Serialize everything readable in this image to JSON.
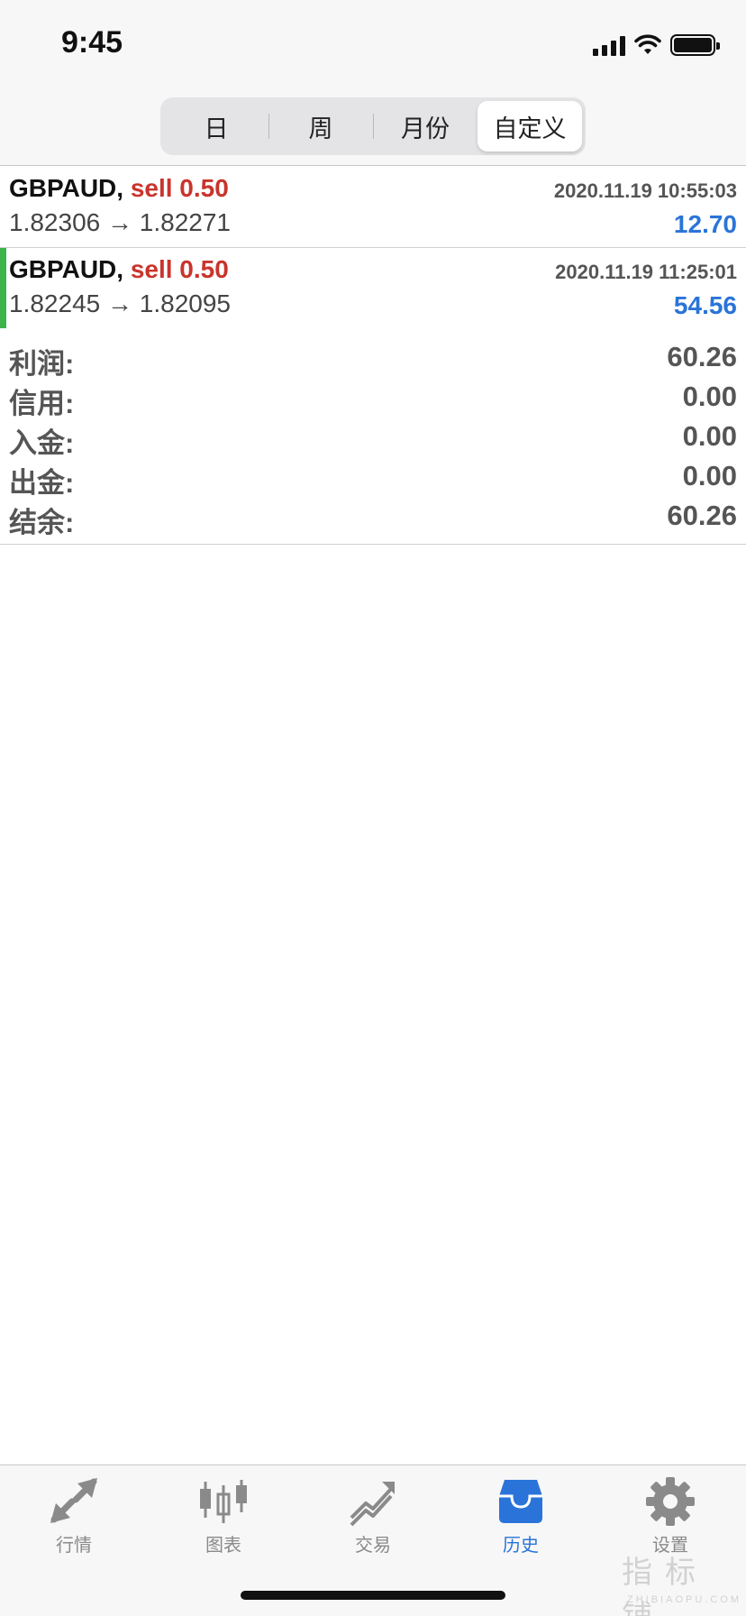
{
  "status_bar": {
    "time": "9:45"
  },
  "periods": {
    "items": [
      "日",
      "周",
      "月份",
      "自定义"
    ],
    "selected": "自定义"
  },
  "trades": [
    {
      "symbol": "GBPAUD",
      "separator": ",",
      "side": "sell 0.50",
      "time": "2020.11.19 10:55:03",
      "prices": "1.82306 → 1.82271",
      "profit": "12.70"
    },
    {
      "symbol": "GBPAUD",
      "separator": ",",
      "side": "sell 0.50",
      "time": "2020.11.19 11:25:01",
      "prices": "1.82245 → 1.82095",
      "profit": "54.56"
    }
  ],
  "summary": [
    {
      "label": "利润:",
      "value": "60.26"
    },
    {
      "label": "信用:",
      "value": "0.00"
    },
    {
      "label": "入金:",
      "value": "0.00"
    },
    {
      "label": "出金:",
      "value": "0.00"
    },
    {
      "label": "结余:",
      "value": "60.26"
    }
  ],
  "tab_bar": {
    "items": [
      {
        "label": "行情",
        "icon": "quotes-arrows-icon"
      },
      {
        "label": "图表",
        "icon": "candlestick-chart-icon"
      },
      {
        "label": "交易",
        "icon": "trade-trend-icon"
      },
      {
        "label": "历史",
        "icon": "history-tray-icon"
      },
      {
        "label": "设置",
        "icon": "gear-icon"
      }
    ],
    "selected": "历史"
  },
  "colors": {
    "sell": "#c9342c",
    "profit": "#2a74d9",
    "active_tab": "#2a74d9",
    "inactive_tab": "#8a8a8a",
    "selected_trade_marker": "#3cb44b"
  },
  "watermark": {
    "cn": "指标铺",
    "en": "ZHIBIAOPU.COM"
  }
}
